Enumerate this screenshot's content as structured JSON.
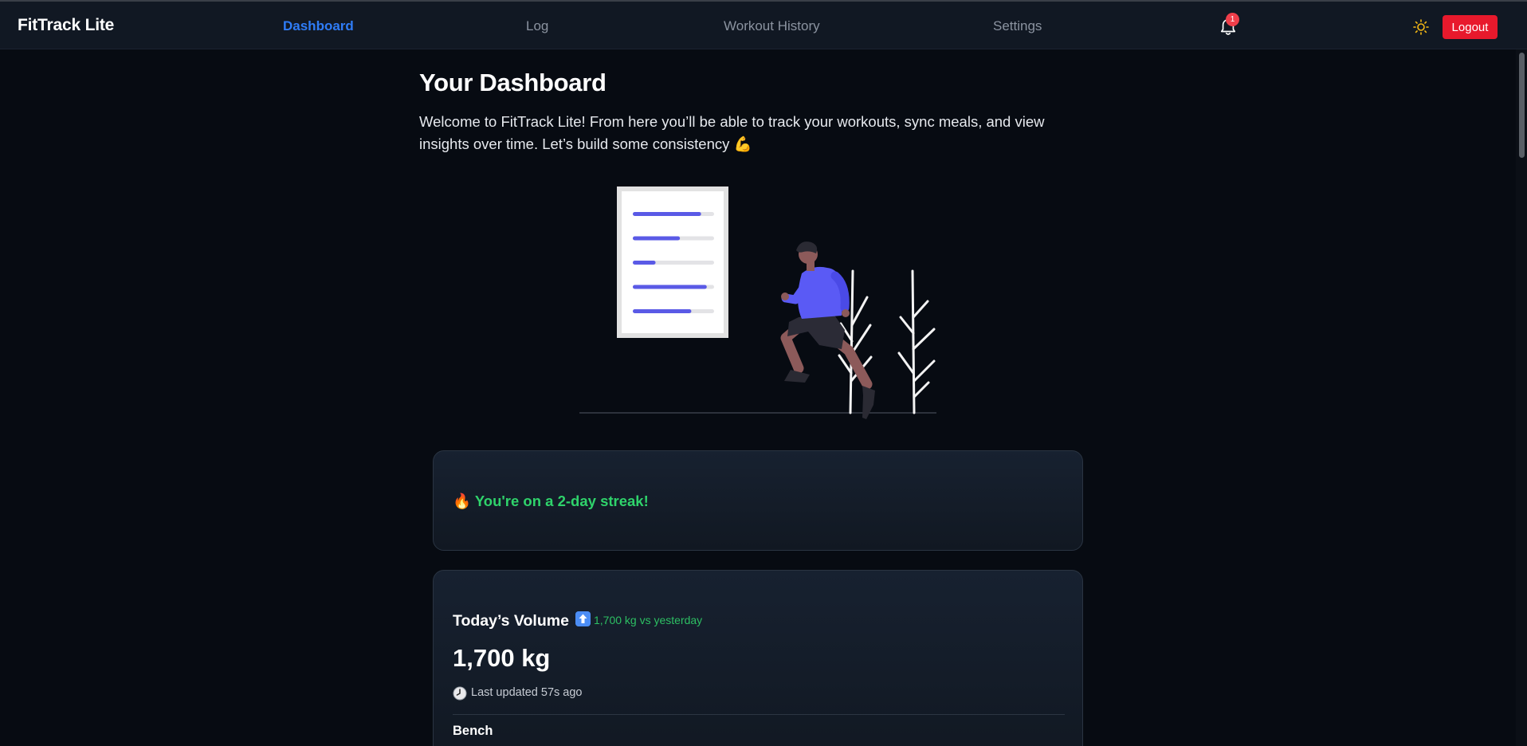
{
  "app": {
    "name": "FitTrack Lite"
  },
  "nav": {
    "items": [
      {
        "label": "Dashboard",
        "active": true
      },
      {
        "label": "Log",
        "active": false
      },
      {
        "label": "Workout History",
        "active": false
      },
      {
        "label": "Settings",
        "active": false
      }
    ],
    "notification_count": "1",
    "notification_icon": "bell-icon",
    "theme_icon": "sun-icon",
    "logout_label": "Logout"
  },
  "page": {
    "title": "Your Dashboard",
    "welcome": "Welcome to FitTrack Lite! From here you’ll be able to track your workouts, sync meals, and view insights over time. Let’s build some consistency 💪"
  },
  "streak": {
    "text": "🔥 You're on a 2-day streak!"
  },
  "volume": {
    "title": "Today’s Volume",
    "delta_icon": "up-arrow-icon",
    "delta_text": "1,700 kg vs yesterday",
    "value": "1,700 kg",
    "updated_icon": "clock-icon",
    "updated_text": "Last updated 57s ago",
    "first_exercise": "Bench"
  },
  "illustration": {
    "name": "runner-illustration",
    "progress_levels": [
      0.84,
      0.58,
      0.28,
      0.91,
      0.72
    ]
  },
  "colors": {
    "accent": "#2f7cf6",
    "streak": "#2fd36b",
    "logout": "#e8192c",
    "badge": "#ef3e4a",
    "illustration_bar": "#5a5ae6"
  }
}
